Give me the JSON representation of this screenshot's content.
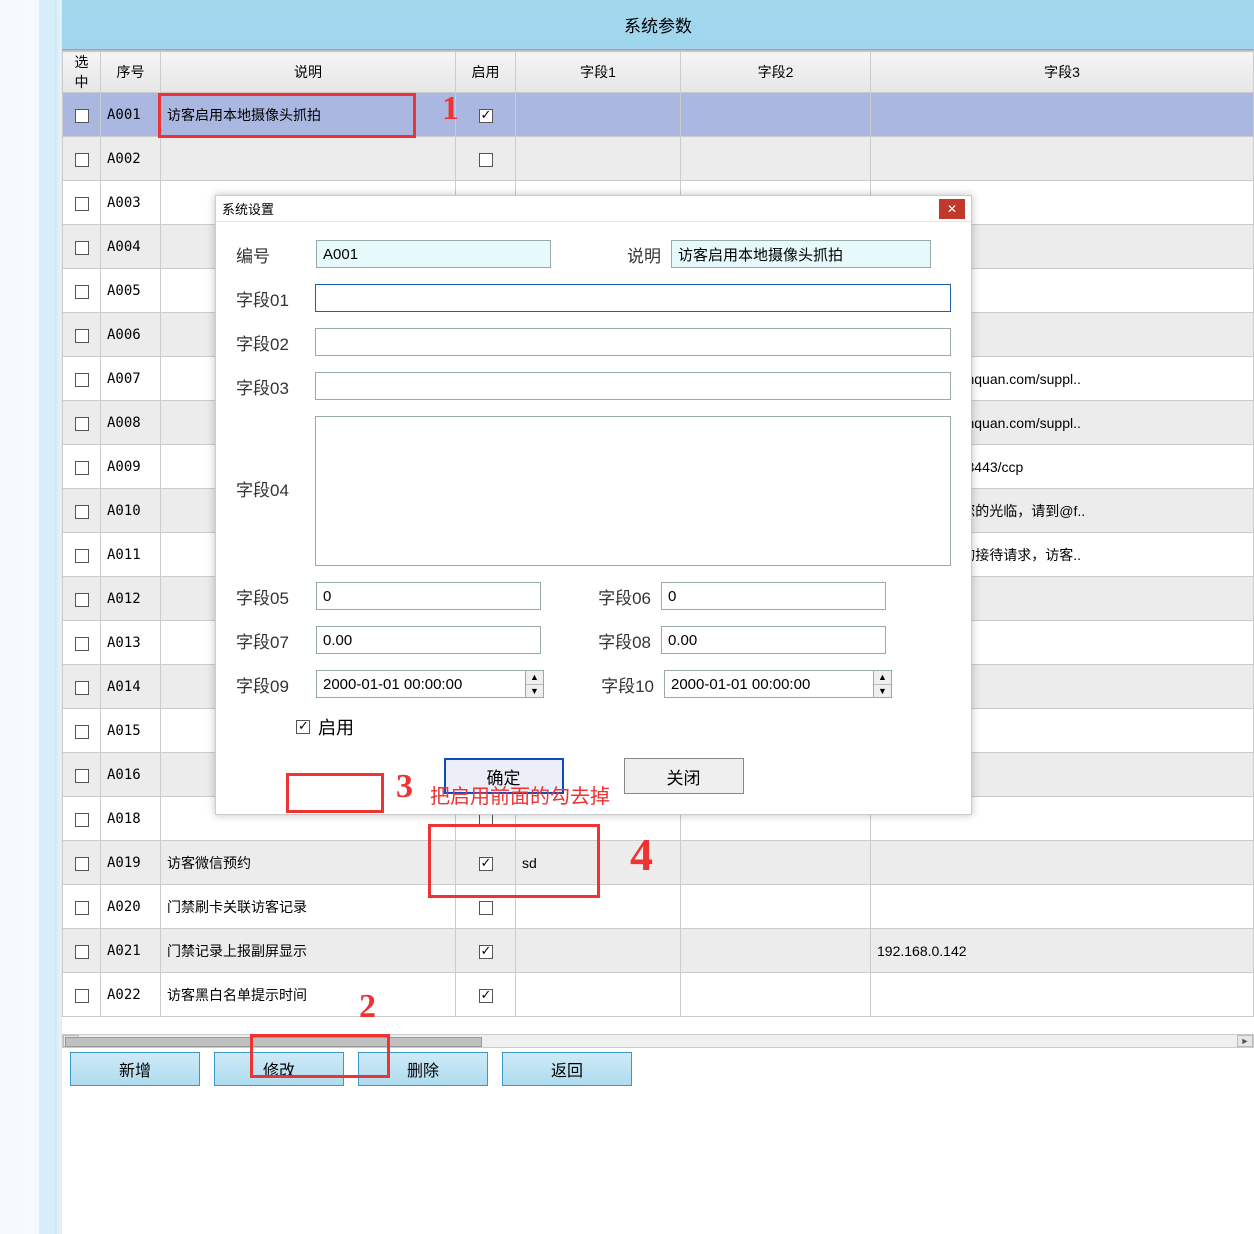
{
  "header": {
    "title": "系统参数"
  },
  "columns": {
    "select": "选中",
    "no": "序号",
    "desc": "说明",
    "enable": "启用",
    "f1": "字段1",
    "f2": "字段2",
    "f3": "字段3"
  },
  "rows": [
    {
      "no": "A001",
      "desc": "访客启用本地摄像头抓拍",
      "enable": true,
      "f1": "",
      "f2": "",
      "f3": "",
      "selected": true
    },
    {
      "no": "A002",
      "desc": "",
      "enable": false,
      "f1": "",
      "f2": "",
      "f3": ""
    },
    {
      "no": "A003",
      "desc": "",
      "enable": false,
      "f1": "",
      "f2": "",
      "f3": ""
    },
    {
      "no": "A004",
      "desc": "",
      "enable": false,
      "f1": "",
      "f2": "",
      "f3": ""
    },
    {
      "no": "A005",
      "desc": "",
      "enable": false,
      "f1": "",
      "f2": "",
      "f3": ""
    },
    {
      "no": "A006",
      "desc": "",
      "enable": false,
      "f1": "",
      "f2": "",
      "f3": ""
    },
    {
      "no": "A007",
      "desc": "",
      "enable": false,
      "f1": "",
      "f2": "",
      "f3": "//www.renrunanquan.com/suppl.."
    },
    {
      "no": "A008",
      "desc": "",
      "enable": false,
      "f1": "",
      "f2": "",
      "f3": "//www.renrunanquan.com/suppl.."
    },
    {
      "no": "A009",
      "desc": "",
      "enable": false,
      "f1": "",
      "f2": "",
      "f3": "://47.104.0.84:8443/ccp"
    },
    {
      "no": "A010",
      "desc": "",
      "enable": false,
      "f1": "",
      "f2": "",
      "f3": "@fkaa02欢迎您的光临，请到@f.."
    },
    {
      "no": "A011",
      "desc": "",
      "enable": false,
      "f1": "",
      "f2": "",
      "f3": "@fkab02有新的接待请求，访客.."
    },
    {
      "no": "A012",
      "desc": "",
      "enable": false,
      "f1": "",
      "f2": "",
      "f3": ""
    },
    {
      "no": "A013",
      "desc": "",
      "enable": false,
      "f1": "",
      "f2": "",
      "f3": ""
    },
    {
      "no": "A014",
      "desc": "",
      "enable": false,
      "f1": "",
      "f2": "",
      "f3": ""
    },
    {
      "no": "A015",
      "desc": "",
      "enable": false,
      "f1": "",
      "f2": "",
      "f3": ""
    },
    {
      "no": "A016",
      "desc": "",
      "enable": false,
      "f1": "",
      "f2": "",
      "f3": ""
    },
    {
      "no": "A018",
      "desc": "",
      "enable": false,
      "f1": "",
      "f2": "",
      "f3": ""
    },
    {
      "no": "A019",
      "desc": "访客微信预约",
      "enable": true,
      "f1": "sd",
      "f2": "",
      "f3": ""
    },
    {
      "no": "A020",
      "desc": "门禁刷卡关联访客记录",
      "enable": false,
      "f1": "",
      "f2": "",
      "f3": ""
    },
    {
      "no": "A021",
      "desc": "门禁记录上报副屏显示",
      "enable": true,
      "f1": "",
      "f2": "",
      "f3": "192.168.0.142"
    },
    {
      "no": "A022",
      "desc": "访客黑白名单提示时间",
      "enable": true,
      "f1": "",
      "f2": "",
      "f3": ""
    }
  ],
  "toolbar": {
    "add": "新增",
    "edit": "修改",
    "delete": "删除",
    "back": "返回"
  },
  "dialog": {
    "title": "系统设置",
    "labels": {
      "no": "编号",
      "desc": "说明",
      "f01": "字段01",
      "f02": "字段02",
      "f03": "字段03",
      "f04": "字段04",
      "f05": "字段05",
      "f06": "字段06",
      "f07": "字段07",
      "f08": "字段08",
      "f09": "字段09",
      "f10": "字段10",
      "enable": "启用"
    },
    "values": {
      "no": "A001",
      "desc": "访客启用本地摄像头抓拍",
      "f01": "",
      "f02": "",
      "f03": "",
      "f04": "",
      "f05": "0",
      "f06": "0",
      "f07": "0.00",
      "f08": "0.00",
      "f09": "2000-01-01 00:00:00",
      "f10": "2000-01-01 00:00:00",
      "enable": true
    },
    "buttons": {
      "ok": "确定",
      "close": "关闭"
    }
  },
  "annotations": {
    "tip": "把启用前面的勾去掉"
  }
}
